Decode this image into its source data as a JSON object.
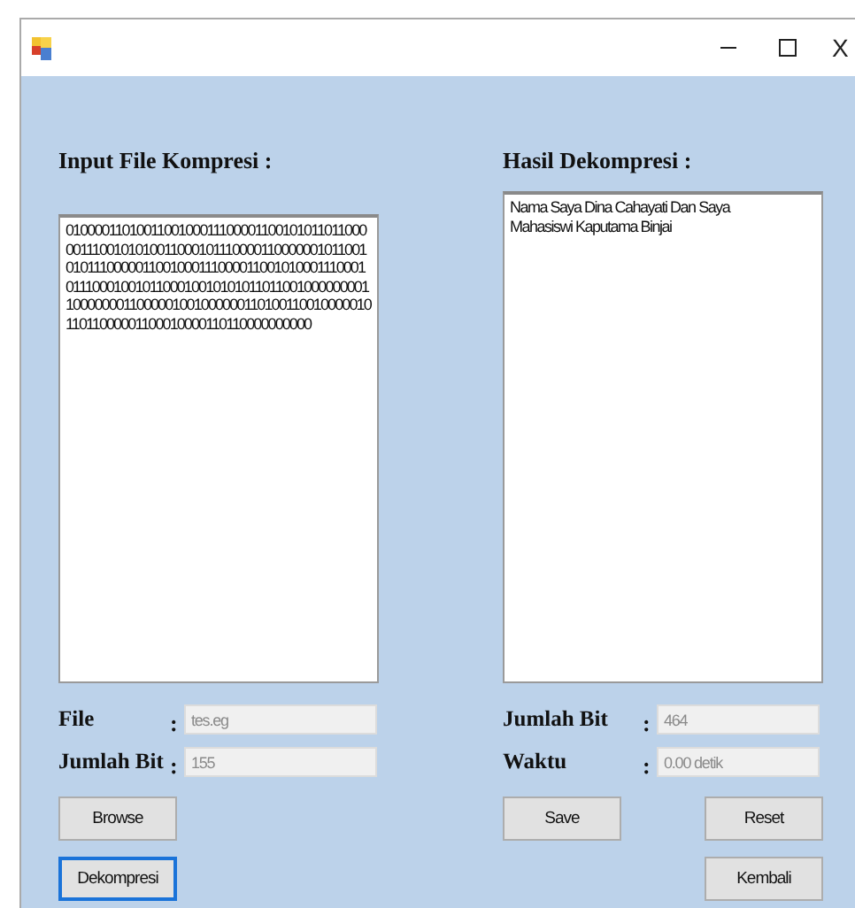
{
  "window": {
    "title_bar": {
      "close_label": "X"
    }
  },
  "input_panel": {
    "heading": "Input File Kompresi :",
    "content": "0100001101001100100011100001100101011011000001110010101001100010111000011000000101100101011100000110010001110000110010100011100010111000100101100010010101011011001000000001100000001100000100100000011010011001000001011011000001100010000110110000000000",
    "fields": [
      {
        "label": "File",
        "colon": ":",
        "value": "tes.eg"
      },
      {
        "label": "Jumlah Bit",
        "colon": ":",
        "value": "155"
      }
    ],
    "buttons": [
      {
        "label": "Browse",
        "focused": false
      },
      {
        "label": "Dekompresi",
        "focused": true
      }
    ]
  },
  "output_panel": {
    "heading": "Hasil Dekompresi :",
    "content": "Nama Saya Dina Cahayati Dan Saya Mahasiswi Kaputama Binjai",
    "fields": [
      {
        "label": "Jumlah Bit",
        "colon": ":",
        "value": "464"
      },
      {
        "label": "Waktu",
        "colon": ":",
        "value": "0.00 detik"
      }
    ],
    "buttons": [
      {
        "label": "Save",
        "focused": false
      },
      {
        "label": "Reset",
        "focused": false
      },
      {
        "label": "Kembali",
        "focused": false
      }
    ]
  }
}
